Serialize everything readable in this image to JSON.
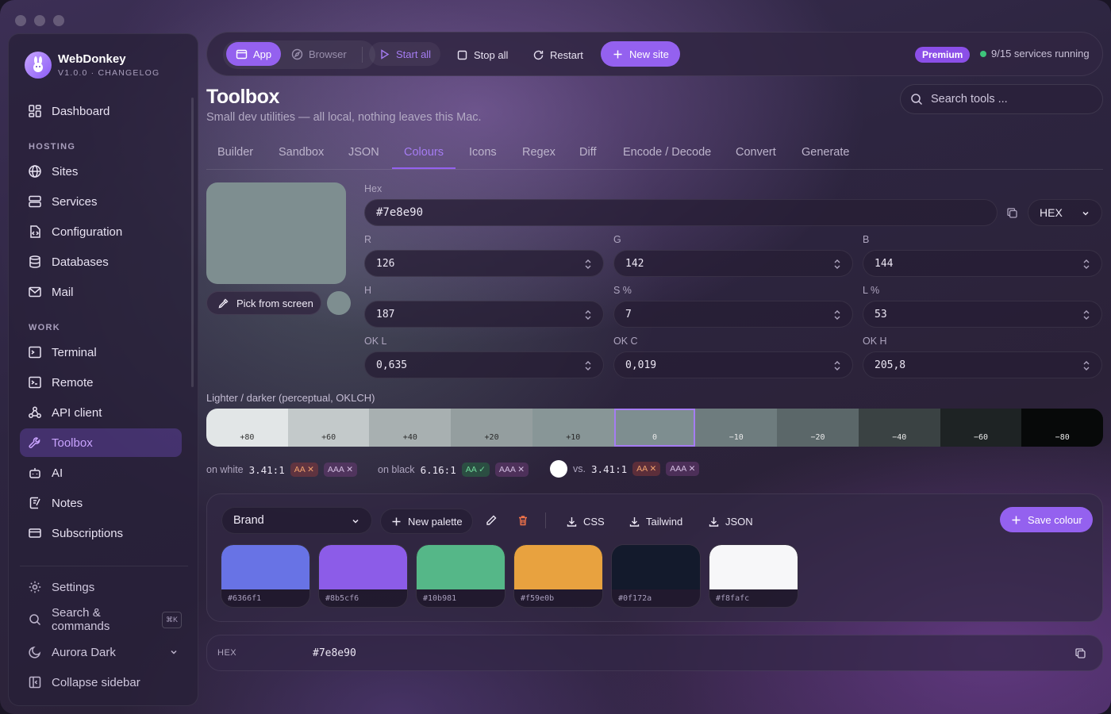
{
  "app": {
    "name": "WebDonkey",
    "version_label": "V1.0.0 · CHANGELOG"
  },
  "sidebar": {
    "dashboard": "Dashboard",
    "hosting_header": "HOSTING",
    "hosting": [
      "Sites",
      "Services",
      "Configuration",
      "Databases",
      "Mail"
    ],
    "work_header": "WORK",
    "work": [
      "Terminal",
      "Remote",
      "API client",
      "Toolbox",
      "AI",
      "Notes",
      "Subscriptions"
    ],
    "active": "Toolbox",
    "settings": "Settings",
    "search": "Search & commands",
    "search_shortcut": "⌘K",
    "theme": "Aurora Dark",
    "collapse": "Collapse sidebar"
  },
  "toolbar": {
    "app": "App",
    "browser": "Browser",
    "start_all": "Start all",
    "stop_all": "Stop all",
    "restart": "Restart",
    "new_site": "New site",
    "premium": "Premium",
    "services_status": "9/15 services running"
  },
  "page": {
    "title": "Toolbox",
    "subtitle": "Small dev utilities — all local, nothing leaves this Mac.",
    "search_placeholder": "Search tools ..."
  },
  "tabs": [
    "Builder",
    "Sandbox",
    "JSON",
    "Colours",
    "Icons",
    "Regex",
    "Diff",
    "Encode / Decode",
    "Convert",
    "Generate"
  ],
  "active_tab": "Colours",
  "colour": {
    "preview": "#7e8e90",
    "pick_label": "Pick from screen",
    "hex_label": "Hex",
    "hex_value": "#7e8e90",
    "format": "HEX",
    "fields": {
      "r": {
        "label": "R",
        "value": "126"
      },
      "g": {
        "label": "G",
        "value": "142"
      },
      "b": {
        "label": "B",
        "value": "144"
      },
      "h": {
        "label": "H",
        "value": "187"
      },
      "s": {
        "label": "S %",
        "value": "7"
      },
      "l": {
        "label": "L %",
        "value": "53"
      },
      "okl": {
        "label": "OK L",
        "value": "0,635"
      },
      "okc": {
        "label": "OK C",
        "value": "0,019"
      },
      "okh": {
        "label": "OK H",
        "value": "205,8"
      }
    }
  },
  "ramp": {
    "label": "Lighter / darker (perceptual, OKLCH)",
    "steps": [
      {
        "label": "+80",
        "color": "#e2e6e7",
        "text": "#333"
      },
      {
        "label": "+60",
        "color": "#c3c9ca",
        "text": "#333"
      },
      {
        "label": "+40",
        "color": "#a8b0b1",
        "text": "#2a2a2a"
      },
      {
        "label": "+20",
        "color": "#949e9f",
        "text": "#2a2a2a"
      },
      {
        "label": "+10",
        "color": "#889697",
        "text": "#2a2a2a"
      },
      {
        "label": "0",
        "color": "#7e8e90",
        "text": "#e8e8e8"
      },
      {
        "label": "−10",
        "color": "#6e7c7e",
        "text": "#eaeaea"
      },
      {
        "label": "−20",
        "color": "#5b6769",
        "text": "#eaeaea"
      },
      {
        "label": "−40",
        "color": "#3a4243",
        "text": "#eaeaea"
      },
      {
        "label": "−60",
        "color": "#1e2324",
        "text": "#eaeaea"
      },
      {
        "label": "−80",
        "color": "#070909",
        "text": "#eaeaea"
      }
    ],
    "selected": "0"
  },
  "contrast": {
    "on_white_label": "on white",
    "on_white": "3.41:1",
    "on_black_label": "on black",
    "on_black": "6.16:1",
    "vs_label": "vs.",
    "vs": "3.41:1",
    "aa_fail": "AA ✕",
    "aaa_fail": "AAA ✕",
    "aa_pass": "AA ✓"
  },
  "palette": {
    "name": "Brand",
    "new_palette": "New palette",
    "css": "CSS",
    "tailwind": "Tailwind",
    "json": "JSON",
    "save": "Save colour",
    "colors": [
      "#6366f1",
      "#8b5cf6",
      "#10b981",
      "#f59e0b",
      "#0f172a",
      "#f8fafc"
    ],
    "swatches": [
      "#6873e5",
      "#8c5ce8",
      "#55b788",
      "#e8a23f",
      "#131a2c",
      "#f7f7f9"
    ]
  },
  "output": {
    "label": "HEX",
    "value": "#7e8e90"
  },
  "colors": {
    "accent": "#9461ef",
    "accent_text": "#a57cf2",
    "status_green": "#3ec47b"
  }
}
